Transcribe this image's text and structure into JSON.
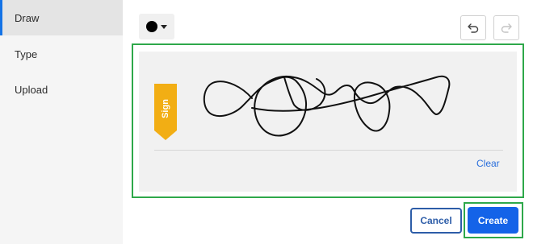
{
  "sidebar": {
    "items": [
      {
        "label": "Draw",
        "active": true
      },
      {
        "label": "Type",
        "active": false
      },
      {
        "label": "Upload",
        "active": false
      }
    ]
  },
  "toolbar": {
    "pen_color": "#000000",
    "color_icon": "color-dot-icon",
    "undo_icon": "undo-icon",
    "redo_icon": "redo-icon"
  },
  "canvas": {
    "sign_label": "Sign",
    "clear_label": "Clear",
    "flag_color": "#f2ae14"
  },
  "footer": {
    "cancel_label": "Cancel",
    "create_label": "Create"
  },
  "colors": {
    "accent": "#1463e8",
    "highlight": "#2ea84a",
    "link": "#2a6fdc"
  }
}
